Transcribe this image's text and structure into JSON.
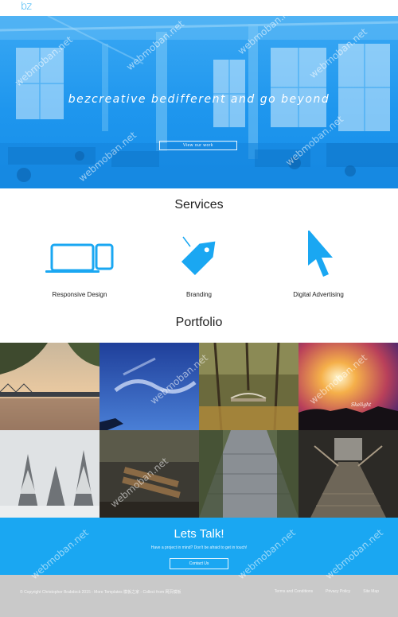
{
  "header": {
    "logo": "bz"
  },
  "hero": {
    "title": "bezcreative bedifferent and go beyond",
    "button_label": "View our work"
  },
  "services": {
    "title": "Services",
    "items": [
      {
        "label": "Responsive Design",
        "icon": "devices-icon"
      },
      {
        "label": "Branding",
        "icon": "tag-icon"
      },
      {
        "label": "Digital Advertising",
        "icon": "cursor-icon"
      }
    ]
  },
  "portfolio": {
    "title": "Portfolio",
    "tiles": [
      {
        "subject": "bridge-river-photo"
      },
      {
        "subject": "blue-sky-photo"
      },
      {
        "subject": "forest-footbridge-photo"
      },
      {
        "subject": "sunset-silhouette-photo",
        "caption": "Skelight"
      },
      {
        "subject": "snowy-trees-photo"
      },
      {
        "subject": "wooden-bench-photo"
      },
      {
        "subject": "brick-path-photo"
      },
      {
        "subject": "wooden-bridge-photo"
      }
    ]
  },
  "cta": {
    "title": "Lets Talk!",
    "subtitle": "Have a project in mind? Don't be afraid to get in touch!",
    "button_label": "Contact Us"
  },
  "footer": {
    "copyright": "© Copyright Christopher Brabdock 2015 - More Templates 模板之家 - Collect from 网页模板",
    "links": [
      "Terms and Conditions",
      "Privacy Policy",
      "Site Map"
    ]
  },
  "watermark": "webmoban.net",
  "colors": {
    "accent": "#1aa7f2",
    "footer": "#c9c9c9"
  }
}
